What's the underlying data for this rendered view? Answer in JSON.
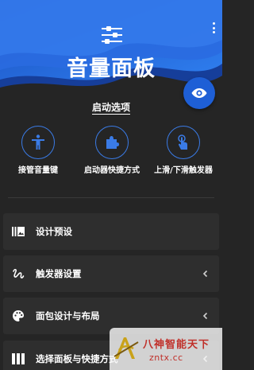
{
  "header": {
    "title": "音量面板",
    "logo_icon": "sliders-icon",
    "more_icon": "more-vert-icon"
  },
  "eye_button": {
    "icon": "eye-icon",
    "color": "#1e5fd6"
  },
  "launch": {
    "title": "启动选项",
    "items": [
      {
        "label": "接管音量键",
        "icon": "accessibility-icon"
      },
      {
        "label": "启动器快捷方式",
        "icon": "puzzle-icon"
      },
      {
        "label": "上滑/下滑触发器",
        "icon": "touch-icon"
      }
    ]
  },
  "settings": {
    "items": [
      {
        "label": "设计预设",
        "icon": "panel-preset-icon",
        "chevron": false
      },
      {
        "label": "触发器设置",
        "icon": "gesture-icon",
        "chevron": true
      },
      {
        "label": "面包设计与布局",
        "icon": "palette-icon",
        "chevron": true
      },
      {
        "label": "选择面板与快捷方式",
        "icon": "columns-icon",
        "chevron": true
      }
    ]
  },
  "watermark": {
    "line1": "八神智能天下",
    "line2": "zntx.cc"
  },
  "colors": {
    "background": "#252525",
    "row": "#2e2e2e",
    "accent": "#1e5fd6",
    "ring": "#3a7be6"
  }
}
